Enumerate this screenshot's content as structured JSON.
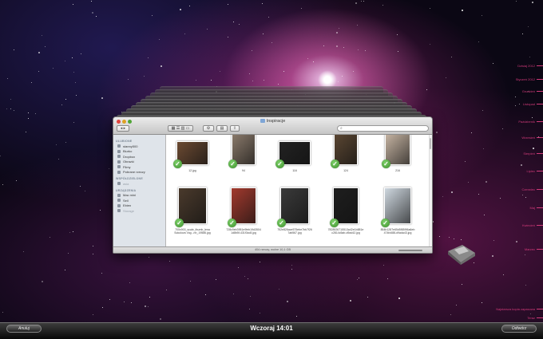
{
  "finder": {
    "title": "Inspiracje",
    "sidebar": [
      {
        "heading": "ULUBIONE",
        "items": [
          {
            "label": "stanny500",
            "icon": "home-icon"
          },
          {
            "label": "Biurko",
            "icon": "desktop-icon"
          },
          {
            "label": "Dropbox",
            "icon": "dropbox-icon"
          },
          {
            "label": "Obrazki",
            "icon": "pictures-icon"
          },
          {
            "label": "Filmy",
            "icon": "movies-icon"
          },
          {
            "label": "Pobrane rzeczy",
            "icon": "downloads-icon"
          }
        ]
      },
      {
        "heading": "WSPÓŁDZIELONE",
        "items": [
          {
            "label": "asia",
            "icon": "shared-computer-icon",
            "dim": true
          }
        ]
      },
      {
        "heading": "URZĄDZENIA",
        "items": [
          {
            "label": "Mac mini",
            "icon": "computer-icon"
          },
          {
            "label": "Seil",
            "icon": "disk-icon"
          },
          {
            "label": "Ebien",
            "icon": "disk-icon"
          },
          {
            "label": "Storage",
            "icon": "disk-icon",
            "dim": true
          }
        ]
      }
    ],
    "files": [
      {
        "name": "12.jpg",
        "color": "#6b4a32"
      },
      {
        "name": "94",
        "color": "#8a7a6b"
      },
      {
        "name": "116",
        "color": "#222222"
      },
      {
        "name": "124",
        "color": "#5a4632"
      },
      {
        "name": "216",
        "color": "#c9b7a5"
      },
      {
        "name": "700x900_scale_thumb_lena\nSokolova Vog...nh_19586.jpg",
        "color": "#4a3a2c"
      },
      {
        "name": "728c9eb3951e9feb19d3504\n1d8b5f-431f3cc8.jpg",
        "color": "#a23a2e"
      },
      {
        "name": "752e826ace575ebe7bb7f26\n7ab567.jpg",
        "color": "#3a3a3a"
      },
      {
        "name": "7828926715513a42e1b881e\nc2814c5ab-d9ad42.jpg",
        "color": "#1e1e1e"
      },
      {
        "name": "854b1287e65d5f85f96a6eb\n474fc688-d9ada43.jpg",
        "color": "#cfd8e0"
      }
    ],
    "status": "404 rzeczy, wolne 10,1 GB"
  },
  "timeline": [
    {
      "label": "Dzisiaj 2012"
    },
    {
      "label": "Styczeń 2012"
    },
    {
      "label": "Grudzień"
    },
    {
      "label": "Listopad"
    },
    {
      "label": "Październik"
    },
    {
      "label": "Wrzesień"
    },
    {
      "label": "Sierpień"
    },
    {
      "label": "Lipiec"
    },
    {
      "label": "Czerwiec"
    },
    {
      "label": "Maj"
    },
    {
      "label": "Kwiecień"
    },
    {
      "label": "Marzec"
    },
    {
      "label": "Najstarsza kopia zapasowa"
    },
    {
      "label": "Teraz"
    }
  ],
  "bottombar": {
    "cancel_label": "Anuluj",
    "center_label": "Wczoraj 14:01",
    "restore_label": "Odtwórz"
  },
  "colors": {
    "accent": "#d23a7a",
    "check": "#4aa537"
  }
}
